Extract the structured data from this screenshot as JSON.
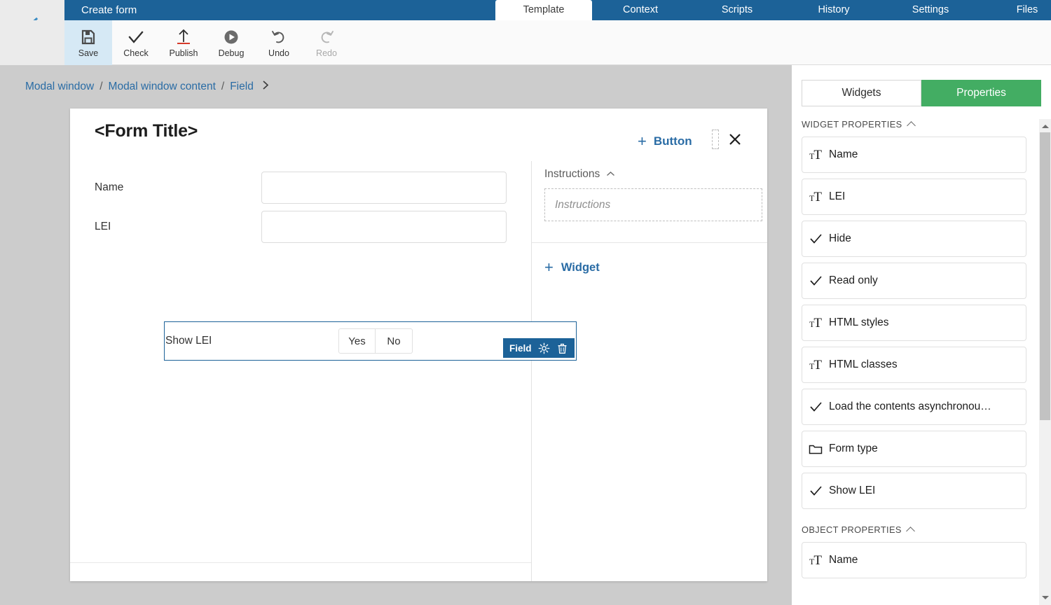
{
  "header": {
    "app_title": "Create form",
    "back_icon": "chevron-left-icon",
    "tabs": [
      {
        "label": "Template",
        "active": true
      },
      {
        "label": "Context",
        "active": false
      },
      {
        "label": "Scripts",
        "active": false
      },
      {
        "label": "History",
        "active": false
      },
      {
        "label": "Settings",
        "active": false
      },
      {
        "label": "Files",
        "active": false
      }
    ]
  },
  "toolbar": {
    "items": [
      {
        "label": "Save",
        "icon": "floppy-disk-icon",
        "state": "selected"
      },
      {
        "label": "Check",
        "icon": "checkmark-icon",
        "state": "enabled"
      },
      {
        "label": "Publish",
        "icon": "upload-arrow-icon",
        "state": "enabled"
      },
      {
        "label": "Debug",
        "icon": "play-circle-icon",
        "state": "enabled"
      },
      {
        "label": "Undo",
        "icon": "undo-arrow-icon",
        "state": "enabled"
      },
      {
        "label": "Redo",
        "icon": "redo-arrow-icon",
        "state": "disabled"
      }
    ]
  },
  "breadcrumb": {
    "items": [
      "Modal window",
      "Modal window content",
      "Field"
    ],
    "separator": "/",
    "trailing_icon": "chevron-right-icon"
  },
  "form": {
    "title": "<Form Title>",
    "add_button_label": "Button",
    "add_button_icon": "plus-icon",
    "close_icon": "close-icon",
    "drag_handle_icon": "drag-placeholder-icon",
    "fields": [
      {
        "label": "Name",
        "value": "",
        "type": "text"
      },
      {
        "label": "LEI",
        "value": "",
        "type": "text"
      }
    ],
    "selected_field": {
      "label": "Show LEI",
      "type": "yesno",
      "options": [
        "Yes",
        "No"
      ],
      "badge": {
        "name": "Field",
        "settings_icon": "gear-icon",
        "delete_icon": "trash-icon"
      }
    },
    "instructions": {
      "section_label": "Instructions",
      "collapse_icon": "chevron-up-icon",
      "placeholder": "Instructions"
    },
    "add_widget_label": "Widget",
    "add_widget_icon": "plus-icon"
  },
  "sidebar": {
    "tabs": [
      {
        "label": "Widgets",
        "active": false
      },
      {
        "label": "Properties",
        "active": true
      }
    ],
    "accent_color": "#43ad63",
    "groups": [
      {
        "title": "WIDGET PROPERTIES",
        "collapse_icon": "chevron-up-icon",
        "items": [
          {
            "label": "Name",
            "icon": "text-type-icon"
          },
          {
            "label": "LEI",
            "icon": "text-type-icon"
          },
          {
            "label": "Hide",
            "icon": "checkmark-icon"
          },
          {
            "label": "Read only",
            "icon": "checkmark-icon"
          },
          {
            "label": "HTML styles",
            "icon": "text-type-icon"
          },
          {
            "label": "HTML classes",
            "icon": "text-type-icon"
          },
          {
            "label": "Load the contents asynchronou…",
            "icon": "checkmark-icon"
          },
          {
            "label": "Form type",
            "icon": "folder-icon"
          },
          {
            "label": "Show LEI",
            "icon": "checkmark-icon"
          }
        ]
      },
      {
        "title": "OBJECT PROPERTIES",
        "collapse_icon": "chevron-up-icon",
        "items": [
          {
            "label": "Name",
            "icon": "text-type-icon"
          }
        ]
      }
    ],
    "scrollbar": {
      "up_icon": "scroll-up-arrow-icon",
      "down_icon": "scroll-down-arrow-icon"
    }
  },
  "colors": {
    "header_blue": "#1c6298",
    "link_blue": "#2a6ca5",
    "green": "#43ad63",
    "canvas_gray": "#cccccc",
    "publish_red": "#d63b2b"
  }
}
